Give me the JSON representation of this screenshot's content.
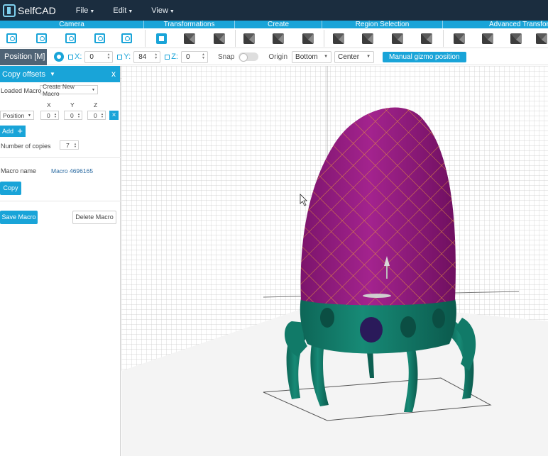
{
  "app": {
    "name": "SelfCAD"
  },
  "menu": [
    {
      "label": "File"
    },
    {
      "label": "Edit"
    },
    {
      "label": "View"
    }
  ],
  "sections": [
    {
      "label": "Camera"
    },
    {
      "label": "Transformations"
    },
    {
      "label": "Create"
    },
    {
      "label": "Region Selection"
    },
    {
      "label": "Advanced Transfor"
    }
  ],
  "position_bar": {
    "label": "Position [M]",
    "x": {
      "axis": "X:",
      "value": "0"
    },
    "y": {
      "axis": "Y:",
      "value": "84"
    },
    "z": {
      "axis": "Z:",
      "value": "0"
    },
    "snap_label": "Snap",
    "origin_label": "Origin",
    "origin_vertical": "Bottom",
    "origin_horizontal": "Center",
    "gizmo_button": "Manual gizmo position"
  },
  "panel": {
    "title": "Copy offsets",
    "close": "x",
    "loaded_macro_label": "Loaded Macro",
    "loaded_macro_value": "Create New Macro",
    "col_x": "X",
    "col_y": "Y",
    "col_z": "Z",
    "offset_type": "Position",
    "offset_x": "0",
    "offset_y": "0",
    "offset_z": "0",
    "remove": "×",
    "add_label": "Add",
    "add_plus": "+",
    "copies_label": "Number of copies",
    "copies_value": "7",
    "macro_name_label": "Macro name",
    "macro_name_value": "Macro 4696165",
    "copy_button": "Copy",
    "save_macro_button": "Save Macro",
    "delete_macro_button": "Delete Macro",
    "collapse": "‹"
  },
  "colors": {
    "accent": "#19a4d8",
    "menubar": "#1b2d3f",
    "egg_top": "#9a1f86",
    "egg_lines": "#e89a3a",
    "base": "#117a68"
  }
}
